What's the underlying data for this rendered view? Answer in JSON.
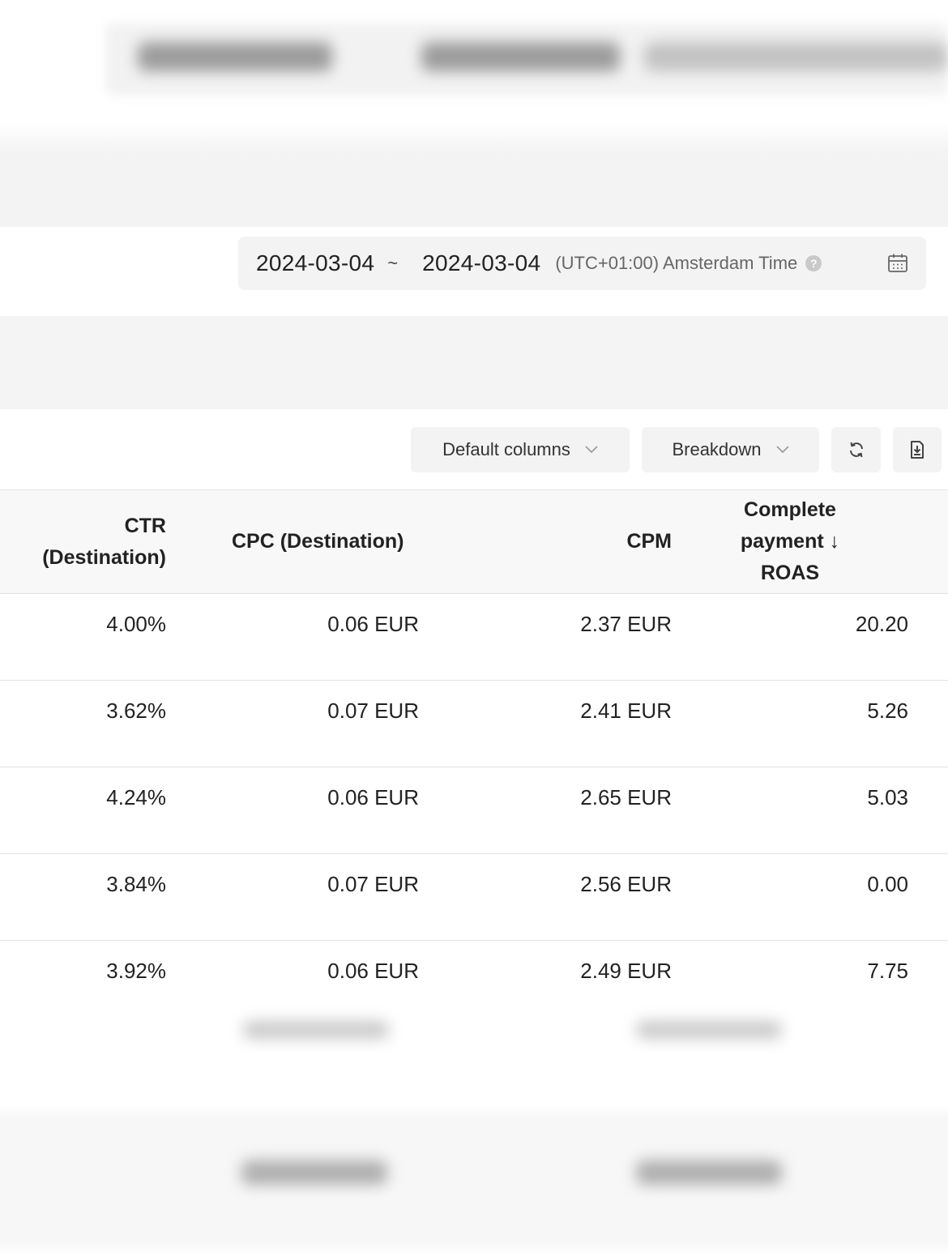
{
  "date_range": {
    "start": "2024-03-04",
    "separator": "~",
    "end": "2024-03-04",
    "timezone": "(UTC+01:00) Amsterdam Time",
    "help_icon": "?"
  },
  "toolbar": {
    "default_columns_label": "Default columns",
    "breakdown_label": "Breakdown"
  },
  "table": {
    "headers": {
      "ctr_line1": "CTR",
      "ctr_line2": "(Destination)",
      "cpc": "CPC (Destination)",
      "cpm": "CPM",
      "roas_line1": "Complete",
      "roas_line2": "payment ↓",
      "roas_line3": "ROAS"
    },
    "rows": [
      {
        "ctr": "4.00%",
        "cpc": "0.06 EUR",
        "cpm": "2.37 EUR",
        "roas": "20.20"
      },
      {
        "ctr": "3.62%",
        "cpc": "0.07 EUR",
        "cpm": "2.41 EUR",
        "roas": "5.26"
      },
      {
        "ctr": "4.24%",
        "cpc": "0.06 EUR",
        "cpm": "2.65 EUR",
        "roas": "5.03"
      },
      {
        "ctr": "3.84%",
        "cpc": "0.07 EUR",
        "cpm": "2.56 EUR",
        "roas": "0.00"
      },
      {
        "ctr": "3.92%",
        "cpc": "0.06 EUR",
        "cpm": "2.49 EUR",
        "roas": "7.75"
      }
    ]
  }
}
